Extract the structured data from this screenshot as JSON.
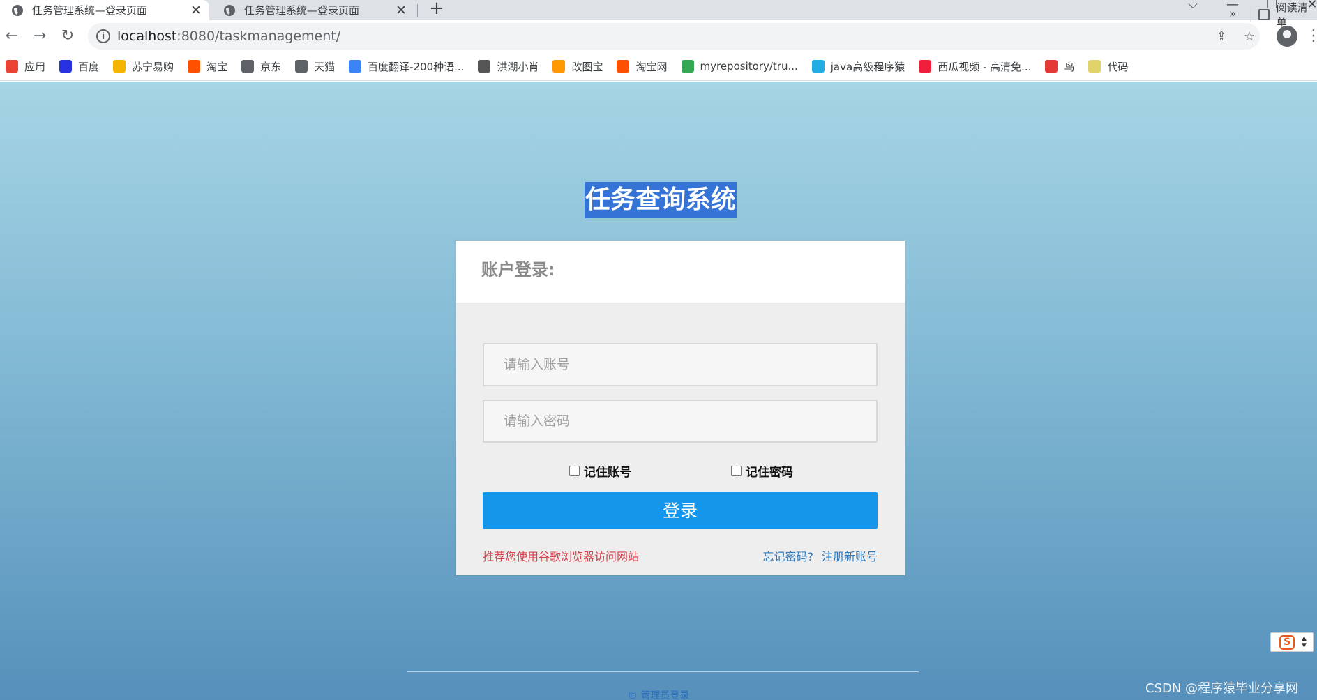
{
  "browser": {
    "tabs": [
      {
        "title": "任务管理系统—登录页面",
        "close": "✕",
        "active": true
      },
      {
        "title": "任务管理系统—登录页面",
        "close": "✕",
        "active": false
      }
    ],
    "new_tab": "+",
    "window_controls": {
      "dropdown": "⌵",
      "minimize": "—",
      "restore": "❐",
      "close": "✕"
    },
    "url_host": "localhost",
    "url_rest": ":8080/taskmanagement/",
    "bookmarks": [
      {
        "label": "应用",
        "icon": "apps-grid-icon",
        "color": "#ea4335"
      },
      {
        "label": "百度",
        "icon": "baidu-paw-icon",
        "color": "#2932e1"
      },
      {
        "label": "苏宁易购",
        "icon": "suning-icon",
        "color": "#f5b400"
      },
      {
        "label": "淘宝",
        "icon": "taobao-icon",
        "color": "#ff5000"
      },
      {
        "label": "京东",
        "icon": "globe-icon",
        "color": "#5f6368"
      },
      {
        "label": "天猫",
        "icon": "globe-icon",
        "color": "#5f6368"
      },
      {
        "label": "百度翻译-200种语...",
        "icon": "translate-icon",
        "color": "#3b84f5"
      },
      {
        "label": "洪湖小肖",
        "icon": "bird-icon",
        "color": "#555555"
      },
      {
        "label": "改图宝",
        "icon": "gaitubao-icon",
        "color": "#ff9800"
      },
      {
        "label": "淘宝网",
        "icon": "taobao-icon",
        "color": "#ff5000"
      },
      {
        "label": "myrepository/tru...",
        "icon": "chrome-icon",
        "color": "#34a853"
      },
      {
        "label": "java高级程序猿",
        "icon": "bilibili-icon",
        "color": "#23ade5"
      },
      {
        "label": "西瓜视频 - 高清免...",
        "icon": "xigua-icon",
        "color": "#f0203c"
      },
      {
        "label": "鸟",
        "icon": "bird-red-icon",
        "color": "#e53935"
      },
      {
        "label": "代码",
        "icon": "code-icon",
        "color": "#e0d36a"
      }
    ],
    "bookmarks_more": "»",
    "reading_list": "阅读清单"
  },
  "page": {
    "system_title": "任务查询系统",
    "card_title": "账户登录:",
    "username_placeholder": "请输入账号",
    "password_placeholder": "请输入密码",
    "remember_account": "记住账号",
    "remember_password": "记住密码",
    "login_button": "登录",
    "browser_hint": "推荐您使用谷歌浏览器访问网站",
    "forgot_password": "忘记密码?",
    "register": "注册新账号",
    "footer": "© 管理员登录"
  },
  "watermark": "CSDN @程序猿毕业分享网",
  "colors": {
    "login_button": "#1596ea",
    "hint_red": "#d8414c",
    "link_blue": "#2e7bc2",
    "title_highlight": "#3574d6"
  }
}
